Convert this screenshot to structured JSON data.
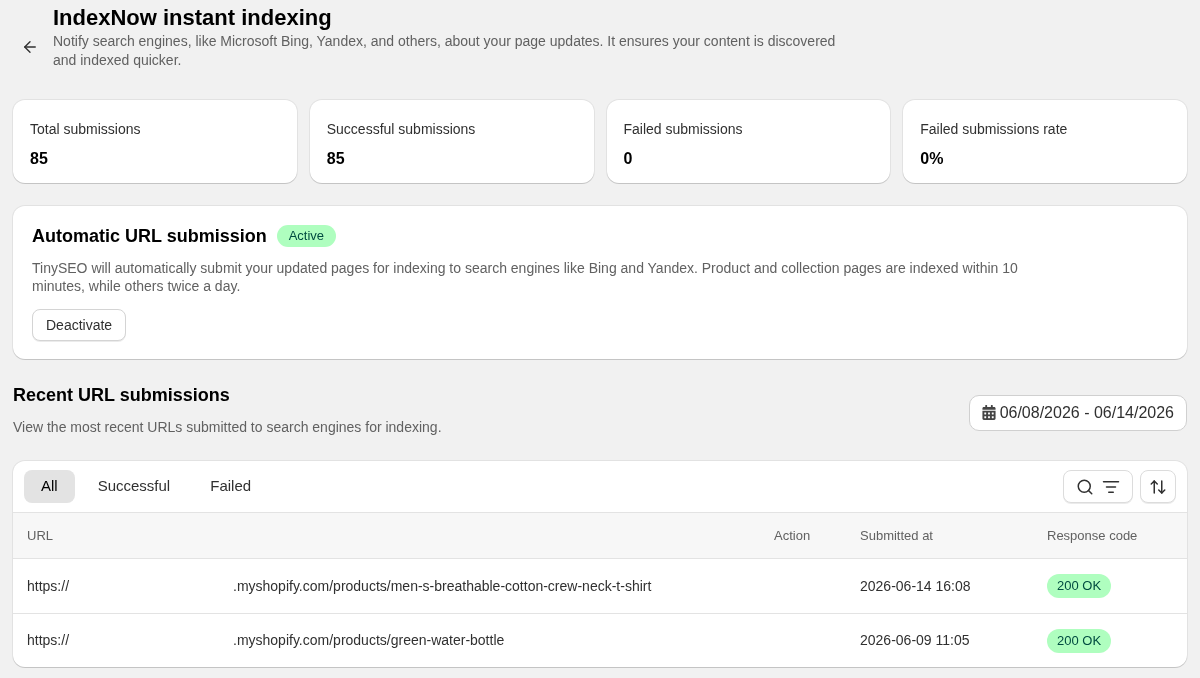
{
  "header": {
    "title": "IndexNow instant indexing",
    "description": "Notify search engines, like Microsoft Bing, Yandex, and others, about your page updates. It ensures your content is discovered and indexed quicker."
  },
  "stats": [
    {
      "label": "Total submissions",
      "value": "85"
    },
    {
      "label": "Successful submissions",
      "value": "85"
    },
    {
      "label": "Failed submissions",
      "value": "0"
    },
    {
      "label": "Failed submissions rate",
      "value": "0%"
    }
  ],
  "auto_submission": {
    "title": "Automatic URL submission",
    "status": "Active",
    "description": "TinySEO will automatically submit your updated pages for indexing to search engines like Bing and Yandex. Product and collection pages are indexed within 10 minutes, while others twice a day.",
    "button": "Deactivate"
  },
  "recent": {
    "title": "Recent URL submissions",
    "subtitle": "View the most recent URLs submitted to search engines for indexing.",
    "date_range": "06/08/2026 - 06/14/2026"
  },
  "table": {
    "tabs": [
      {
        "label": "All",
        "selected": true
      },
      {
        "label": "Successful",
        "selected": false
      },
      {
        "label": "Failed",
        "selected": false
      }
    ],
    "columns": [
      "URL",
      "Action",
      "Submitted at",
      "Response code"
    ],
    "rows": [
      {
        "url_start": "https://",
        "url_end": ".myshopify.com/products/men-s-breathable-cotton-crew-neck-t-shirt",
        "submitted_at": "2026-06-14 16:08",
        "response_code": "200 OK"
      },
      {
        "url_start": "https://",
        "url_end": ".myshopify.com/products/green-water-bottle",
        "submitted_at": "2026-06-09 11:05",
        "response_code": "200 OK"
      }
    ]
  }
}
